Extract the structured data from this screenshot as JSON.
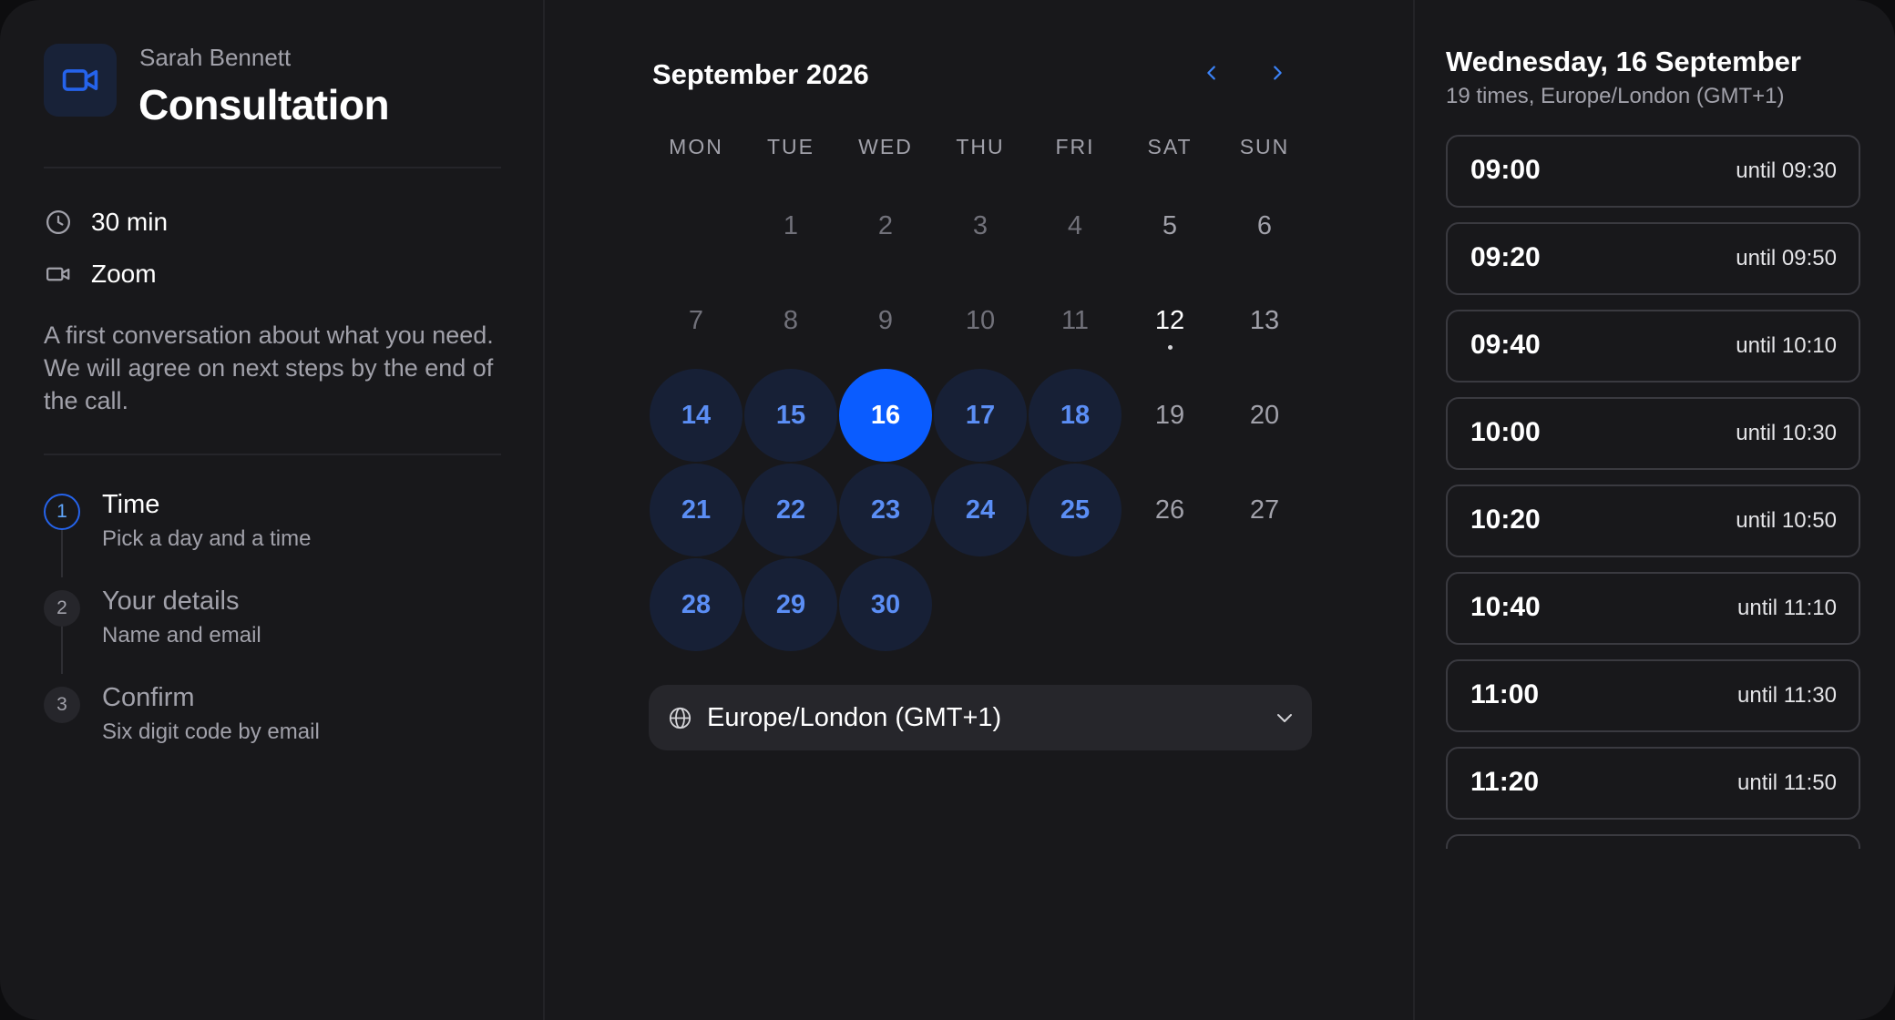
{
  "event": {
    "host_name": "Sarah Bennett",
    "title": "Consultation",
    "icon": "video-camera-icon",
    "accent_color": "#2563eb",
    "duration": "30 min",
    "location": "Zoom",
    "description": "A first conversation about what you need. We will agree on next steps by the end of the call."
  },
  "steps": [
    {
      "number": "1",
      "title": "Time",
      "subtitle": "Pick a day and a time",
      "active": true
    },
    {
      "number": "2",
      "title": "Your details",
      "subtitle": "Name and email",
      "active": false
    },
    {
      "number": "3",
      "title": "Confirm",
      "subtitle": "Six digit code by email",
      "active": false
    }
  ],
  "calendar": {
    "month_label": "September 2026",
    "weekdays": [
      "MON",
      "TUE",
      "WED",
      "THU",
      "FRI",
      "SAT",
      "SUN"
    ],
    "first_weekday_offset": 1,
    "days_in_month": 30,
    "today": 12,
    "selected": 16,
    "available_days": [
      14,
      15,
      16,
      17,
      18,
      21,
      22,
      23,
      24,
      25,
      28,
      29,
      30
    ],
    "prev_icon": "chevron-left-icon",
    "next_icon": "chevron-right-icon",
    "selected_color": "#0a5cff",
    "available_color": "#5b8ef5"
  },
  "timezone": {
    "icon": "globe-icon",
    "value": "Europe/London (GMT+1)"
  },
  "slots_panel": {
    "date_title": "Wednesday, 16 September",
    "subtitle": "19 times, Europe/London (GMT+1)",
    "slots": [
      {
        "time": "09:00",
        "until": "until 09:30"
      },
      {
        "time": "09:20",
        "until": "until 09:50"
      },
      {
        "time": "09:40",
        "until": "until 10:10"
      },
      {
        "time": "10:00",
        "until": "until 10:30"
      },
      {
        "time": "10:20",
        "until": "until 10:50"
      },
      {
        "time": "10:40",
        "until": "until 11:10"
      },
      {
        "time": "11:00",
        "until": "until 11:30"
      },
      {
        "time": "11:20",
        "until": "until 11:50"
      }
    ]
  }
}
